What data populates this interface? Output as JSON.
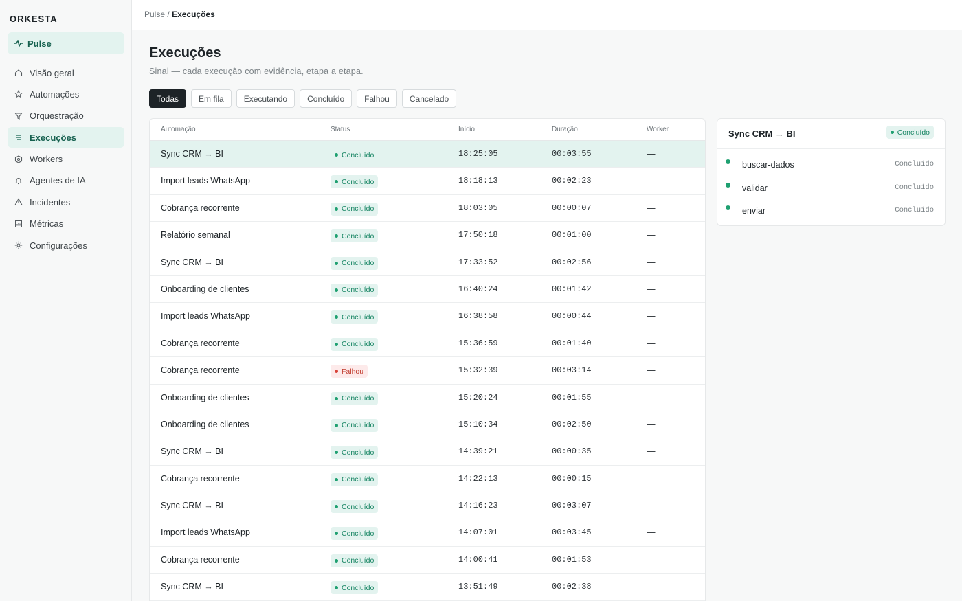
{
  "brand": "ORKESTA",
  "pulse_label": "Pulse",
  "nav": [
    {
      "label": "Visão geral",
      "icon": "home-icon"
    },
    {
      "label": "Automações",
      "icon": "star-icon"
    },
    {
      "label": "Orquestração",
      "icon": "filter-icon"
    },
    {
      "label": "Execuções",
      "icon": "list-icon",
      "active": true
    },
    {
      "label": "Workers",
      "icon": "hexagon-icon"
    },
    {
      "label": "Agentes de IA",
      "icon": "bell-icon"
    },
    {
      "label": "Incidentes",
      "icon": "warning-icon"
    },
    {
      "label": "Métricas",
      "icon": "bar-chart-icon"
    },
    {
      "label": "Configurações",
      "icon": "sun-gear-icon"
    }
  ],
  "breadcrumb": {
    "parent": "Pulse",
    "separator": "/",
    "current": "Execuções"
  },
  "page": {
    "title": "Execuções",
    "subtitle": "Sinal — cada execução com evidência, etapa a etapa."
  },
  "filters": [
    {
      "label": "Todas",
      "active": true
    },
    {
      "label": "Em fila"
    },
    {
      "label": "Executando"
    },
    {
      "label": "Concluído"
    },
    {
      "label": "Falhou"
    },
    {
      "label": "Cancelado"
    }
  ],
  "table": {
    "headers": {
      "automacao": "Automação",
      "status": "Status",
      "inicio": "Início",
      "duracao": "Duração",
      "worker": "Worker"
    },
    "rows": [
      {
        "automacao": "Sync CRM → BI",
        "status": "Concluído",
        "status_kind": "ok",
        "inicio": "18:25:05",
        "duracao": "00:03:55",
        "worker": "—",
        "selected": true
      },
      {
        "automacao": "Import leads WhatsApp",
        "status": "Concluído",
        "status_kind": "ok",
        "inicio": "18:18:13",
        "duracao": "00:02:23",
        "worker": "—"
      },
      {
        "automacao": "Cobrança recorrente",
        "status": "Concluído",
        "status_kind": "ok",
        "inicio": "18:03:05",
        "duracao": "00:00:07",
        "worker": "—"
      },
      {
        "automacao": "Relatório semanal",
        "status": "Concluído",
        "status_kind": "ok",
        "inicio": "17:50:18",
        "duracao": "00:01:00",
        "worker": "—"
      },
      {
        "automacao": "Sync CRM → BI",
        "status": "Concluído",
        "status_kind": "ok",
        "inicio": "17:33:52",
        "duracao": "00:02:56",
        "worker": "—"
      },
      {
        "automacao": "Onboarding de clientes",
        "status": "Concluído",
        "status_kind": "ok",
        "inicio": "16:40:24",
        "duracao": "00:01:42",
        "worker": "—"
      },
      {
        "automacao": "Import leads WhatsApp",
        "status": "Concluído",
        "status_kind": "ok",
        "inicio": "16:38:58",
        "duracao": "00:00:44",
        "worker": "—"
      },
      {
        "automacao": "Cobrança recorrente",
        "status": "Concluído",
        "status_kind": "ok",
        "inicio": "15:36:59",
        "duracao": "00:01:40",
        "worker": "—"
      },
      {
        "automacao": "Cobrança recorrente",
        "status": "Falhou",
        "status_kind": "fail",
        "inicio": "15:32:39",
        "duracao": "00:03:14",
        "worker": "—"
      },
      {
        "automacao": "Onboarding de clientes",
        "status": "Concluído",
        "status_kind": "ok",
        "inicio": "15:20:24",
        "duracao": "00:01:55",
        "worker": "—"
      },
      {
        "automacao": "Onboarding de clientes",
        "status": "Concluído",
        "status_kind": "ok",
        "inicio": "15:10:34",
        "duracao": "00:02:50",
        "worker": "—"
      },
      {
        "automacao": "Sync CRM → BI",
        "status": "Concluído",
        "status_kind": "ok",
        "inicio": "14:39:21",
        "duracao": "00:00:35",
        "worker": "—"
      },
      {
        "automacao": "Cobrança recorrente",
        "status": "Concluído",
        "status_kind": "ok",
        "inicio": "14:22:13",
        "duracao": "00:00:15",
        "worker": "—"
      },
      {
        "automacao": "Sync CRM → BI",
        "status": "Concluído",
        "status_kind": "ok",
        "inicio": "14:16:23",
        "duracao": "00:03:07",
        "worker": "—"
      },
      {
        "automacao": "Import leads WhatsApp",
        "status": "Concluído",
        "status_kind": "ok",
        "inicio": "14:07:01",
        "duracao": "00:03:45",
        "worker": "—"
      },
      {
        "automacao": "Cobrança recorrente",
        "status": "Concluído",
        "status_kind": "ok",
        "inicio": "14:00:41",
        "duracao": "00:01:53",
        "worker": "—"
      },
      {
        "automacao": "Sync CRM → BI",
        "status": "Concluído",
        "status_kind": "ok",
        "inicio": "13:51:49",
        "duracao": "00:02:38",
        "worker": "—"
      }
    ]
  },
  "detail": {
    "title": "Sync CRM → BI",
    "status": "Concluído",
    "steps": [
      {
        "name": "buscar-dados",
        "status": "Concluído"
      },
      {
        "name": "validar",
        "status": "Concluído"
      },
      {
        "name": "enviar",
        "status": "Concluído"
      }
    ]
  },
  "colors": {
    "accent": "#16614f",
    "accent_bg": "#e3f3ef",
    "success": "#1fa071",
    "danger": "#d9433a",
    "dark": "#1d2327"
  }
}
